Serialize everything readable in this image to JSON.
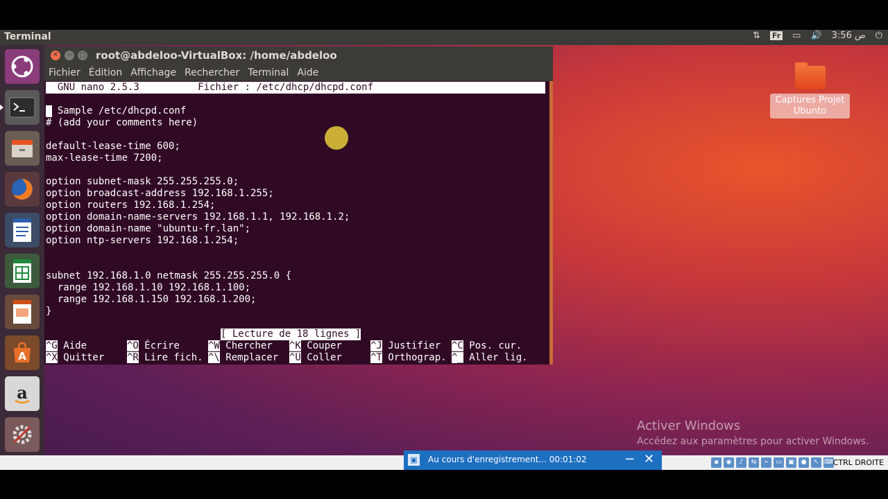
{
  "topbar": {
    "app_name": "Terminal",
    "keyboard_layout": "Fr",
    "clock": "3:56 ص"
  },
  "window": {
    "title": "root@abdeloo-VirtualBox: /home/abdeloo",
    "menu": [
      "Fichier",
      "Édition",
      "Affichage",
      "Rechercher",
      "Terminal",
      "Aide"
    ]
  },
  "nano": {
    "header": "  GNU nano 2.5.3          Fichier : /etc/dhcp/dhcpd.conf",
    "lines": [
      "# Sample /etc/dhcpd.conf",
      "# (add your comments here)",
      "",
      "default-lease-time 600;",
      "max-lease-time 7200;",
      "",
      "option subnet-mask 255.255.255.0;",
      "option broadcast-address 192.168.1.255;",
      "option routers 192.168.1.254;",
      "option domain-name-servers 192.168.1.1, 192.168.1.2;",
      "option domain-name \"ubuntu-fr.lan\";",
      "option ntp-servers 192.168.1.254;",
      "",
      "",
      "subnet 192.168.1.0 netmask 255.255.255.0 {",
      "  range 192.168.1.10 192.168.1.100;",
      "  range 192.168.1.150 192.168.1.200;",
      "}"
    ],
    "status": "[ Lecture de 18 lignes ]",
    "shortcuts": [
      {
        "key": "^G",
        "label": "Aide"
      },
      {
        "key": "^O",
        "label": "Écrire"
      },
      {
        "key": "^W",
        "label": "Chercher"
      },
      {
        "key": "^K",
        "label": "Couper"
      },
      {
        "key": "^J",
        "label": "Justifier"
      },
      {
        "key": "^C",
        "label": "Pos. cur."
      },
      {
        "key": "^X",
        "label": "Quitter"
      },
      {
        "key": "^R",
        "label": "Lire fich."
      },
      {
        "key": "^\\",
        "label": "Remplacer"
      },
      {
        "key": "^U",
        "label": "Coller"
      },
      {
        "key": "^T",
        "label": "Orthograp."
      },
      {
        "key": "^_",
        "label": "Aller lig."
      }
    ]
  },
  "desktop": {
    "folder_label": "Captures Projet Ubunto",
    "watermark_title": "Activer Windows",
    "watermark_sub": "Accédez aux paramètres pour activer Windows."
  },
  "recording": {
    "text": "Au cours d'enregistrement... 00:01:02"
  },
  "vbox": {
    "host_key": "CTRL DROITE"
  },
  "colors": {
    "terminal_bg": "#300a24",
    "panel": "#3c3b37",
    "accent": "#e95420"
  }
}
